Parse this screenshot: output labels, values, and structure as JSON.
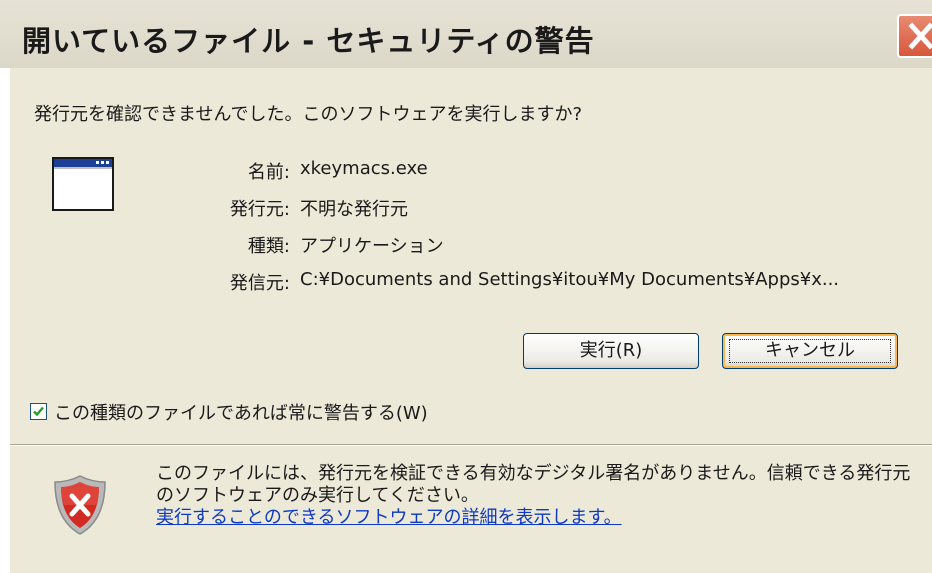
{
  "dialog": {
    "title": "開いているファイル - セキュリティの警告",
    "question": "発行元を確認できませんでした。このソフトウェアを実行しますか?"
  },
  "details": [
    {
      "label": "名前:",
      "value": "xkeymacs.exe"
    },
    {
      "label": "発行元:",
      "value": "不明な発行元"
    },
    {
      "label": "種類:",
      "value": "アプリケーション"
    },
    {
      "label": "発信元:",
      "value": "C:¥Documents and Settings¥itou¥My Documents¥Apps¥x..."
    }
  ],
  "buttons": {
    "run_label": "実行(R)",
    "cancel_label": "キャンセル"
  },
  "checkbox": {
    "label": "この種類のファイルであれば常に警告する(W)",
    "checked": true
  },
  "warning": {
    "text": "このファイルには、発行元を検証できる有効なデジタル署名がありません。信頼できる発行元のソフトウェアのみ実行してください。",
    "link": "実行することのできるソフトウェアの詳細を表示します。"
  },
  "colors": {
    "dialog_background": "#ece9d8",
    "title_bar": "#e6e3d6",
    "close_button": "#d6573c",
    "link": "#0d39c4",
    "checkmark": "#21a121",
    "shield": "#c2201b"
  },
  "icons": [
    "close-icon",
    "application-window-icon",
    "checkmark-icon",
    "security-shield-icon"
  ]
}
